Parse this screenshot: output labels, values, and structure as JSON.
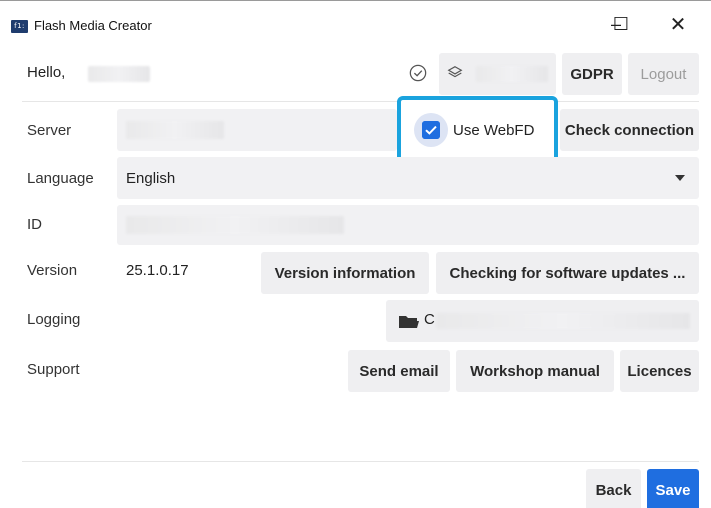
{
  "window": {
    "app_icon_text": "f1:",
    "title": "Flash Media Creator",
    "minimize_glyph": "–",
    "maximize_glyph": "☐",
    "close_glyph": "✕"
  },
  "header": {
    "greeting": "Hello,",
    "gdpr_label": "GDPR",
    "logout_label": "Logout"
  },
  "form": {
    "server": {
      "label": "Server",
      "use_webfd_label": "Use WebFD",
      "use_webfd_checked": true,
      "check_connection_label": "Check connection"
    },
    "language": {
      "label": "Language",
      "value": "English"
    },
    "id": {
      "label": "ID"
    },
    "version": {
      "label": "Version",
      "value": "25.1.0.17",
      "info_button": "Version information",
      "updates_button": "Checking for software updates ..."
    },
    "logging": {
      "label": "Logging",
      "path_prefix": "C"
    },
    "support": {
      "label": "Support",
      "email_button": "Send email",
      "manual_button": "Workshop manual",
      "licences_button": "Licences"
    }
  },
  "footer": {
    "back_label": "Back",
    "save_label": "Save"
  },
  "icons": {
    "status": "check-circle-icon",
    "environment": "layers-icon",
    "logging": "folder-icon",
    "language_dropdown": "caret-down-icon"
  },
  "colors": {
    "accent": "#1f6ee0",
    "highlight_border": "#1aa3de",
    "button_bg": "#efeff1"
  }
}
